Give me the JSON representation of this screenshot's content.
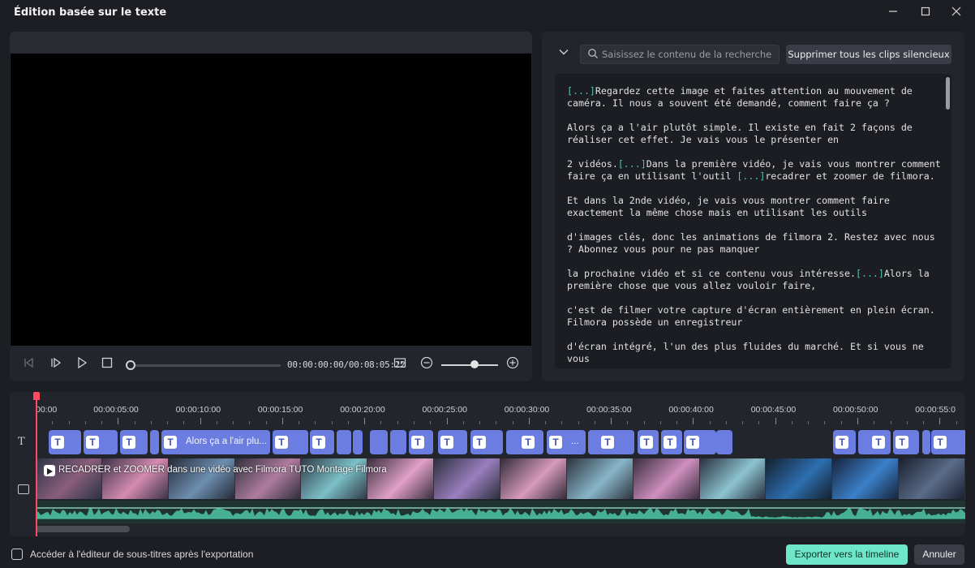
{
  "window": {
    "title": "Édition basée sur le texte",
    "minimize_icon": "minimize-icon",
    "maximize_icon": "maximize-icon",
    "close_icon": "close-icon"
  },
  "player": {
    "timecode": "00:00:00:00/00:08:05:22",
    "progress": 0,
    "zoom_level": 0.6,
    "icons": [
      "prev-frame-icon",
      "next-frame-icon",
      "play-icon",
      "stop-icon",
      "fit-icon",
      "zoom-out-icon",
      "zoom-in-icon"
    ]
  },
  "transcript": {
    "search_placeholder": "Saisissez le contenu de la recherche",
    "delete_silent_label": "Supprimer tous les clips silencieux",
    "paragraphs": [
      [
        {
          "tag": "[...]"
        },
        {
          "t": "Regardez cette image et faites attention au mouvement de caméra. Il nous a souvent été demandé, comment faire ça ?"
        }
      ],
      [
        {
          "t": " Alors ça a l'air plutôt simple. Il existe en fait 2 façons de réaliser cet effet. Je vais vous le présenter en"
        }
      ],
      [
        {
          "t": "2 vidéos."
        },
        {
          "tag": "[...]"
        },
        {
          "t": "Dans la première vidéo, je vais vous montrer comment faire ça en utilisant l'outil "
        },
        {
          "tag": "[...]"
        },
        {
          "t": "recadrer et zoomer de filmora."
        }
      ],
      [
        {
          "t": " Et dans la 2nde vidéo, je vais vous montrer comment faire exactement la même chose mais en utilisant les outils"
        }
      ],
      [
        {
          "t": "d'images clés, donc les animations de filmora 2. Restez avec nous ? Abonnez vous pour ne pas manquer"
        }
      ],
      [
        {
          "t": " la prochaine vidéo et si ce contenu vous intéresse."
        },
        {
          "tag": "[...]"
        },
        {
          "t": "Alors la première chose que vous allez vouloir faire,"
        }
      ],
      [
        {
          "t": " c'est de filmer votre capture d'écran entièrement en plein écran. Filmora possède un enregistreur"
        }
      ],
      [
        {
          "t": " d'écran intégré, l'un des plus fluides du marché. Et si vous ne vous"
        }
      ]
    ]
  },
  "timeline": {
    "ruler_labels": [
      "00:00",
      "00:00:05:00",
      "00:00:10:00",
      "00:00:15:00",
      "00:00:20:00",
      "00:00:25:00",
      "00:00:30:00",
      "00:00:35:00",
      "00:00:40:00",
      "00:00:45:00",
      "00:00:50:00",
      "00:00:55:0"
    ],
    "sub_clip_text": "Alors ça a l'air plu...",
    "sub_clip_ellipsis": "...",
    "sub_icon_glyph": "T",
    "video_title": "RECADRER et ZOOMER dans une vidéo avec Filmora TUTO Montage Filmora",
    "text_track_icon": "text-track-icon",
    "video_track_icon": "video-track-icon"
  },
  "footer": {
    "checkbox_label": "Accéder à l'éditeur de sous-titres après l'exportation",
    "checkbox_checked": false,
    "export_label": "Exporter vers la timeline",
    "cancel_label": "Annuler"
  },
  "colors": {
    "accent": "#6ee7c9",
    "subtitle_clip": "#6b7de0",
    "playhead": "#ff4a5f",
    "waveform": "#4fc7a6",
    "transcript_tag": "#4fc7b5"
  }
}
